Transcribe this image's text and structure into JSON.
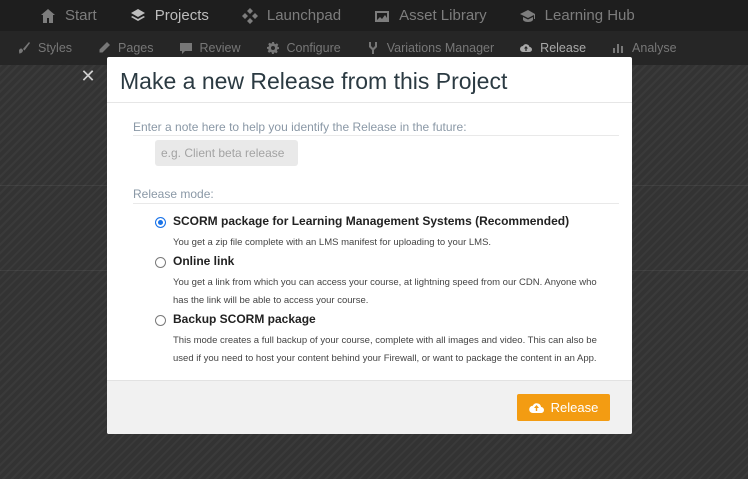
{
  "topnav": {
    "items": [
      {
        "label": "Start",
        "icon": "home-icon"
      },
      {
        "label": "Projects",
        "icon": "layers-icon",
        "active": true
      },
      {
        "label": "Launchpad",
        "icon": "diamond-grid-icon"
      },
      {
        "label": "Asset Library",
        "icon": "images-icon"
      },
      {
        "label": "Learning Hub",
        "icon": "graduation-cap-icon"
      }
    ]
  },
  "subnav": {
    "items": [
      {
        "label": "Styles",
        "icon": "brush-icon"
      },
      {
        "label": "Pages",
        "icon": "pencil-icon"
      },
      {
        "label": "Review",
        "icon": "comment-icon"
      },
      {
        "label": "Configure",
        "icon": "gear-icon"
      },
      {
        "label": "Variations Manager",
        "icon": "branch-icon"
      },
      {
        "label": "Release",
        "icon": "cloud-upload-icon",
        "active": true
      },
      {
        "label": "Analyse",
        "icon": "bar-chart-icon"
      }
    ]
  },
  "modal": {
    "title": "Make a new Release from this Project",
    "note_label": "Enter a note here to help you identify the Release in the future:",
    "note_placeholder": "e.g. Client beta release",
    "note_value": "",
    "mode_label": "Release mode:",
    "options": [
      {
        "title": "SCORM package for Learning Management Systems (Recommended)",
        "desc": "You get a zip file complete with an LMS manifest for uploading to your LMS.",
        "checked": true
      },
      {
        "title": "Online link",
        "desc": "You get a link from which you can access your course, at lightning speed from our CDN. Anyone who has the link will be able to access your course.",
        "checked": false
      },
      {
        "title": "Backup SCORM package",
        "desc": "This mode creates a full backup of your course, complete with all images and video. This can also be used if you need to host your content behind your Firewall, or want to package the content in an App.",
        "checked": false
      }
    ],
    "release_button": "Release",
    "close_glyph": "✕"
  },
  "colors": {
    "accent": "#f39c12",
    "radio_checked": "#1a73e8",
    "title": "#2b3a42"
  }
}
